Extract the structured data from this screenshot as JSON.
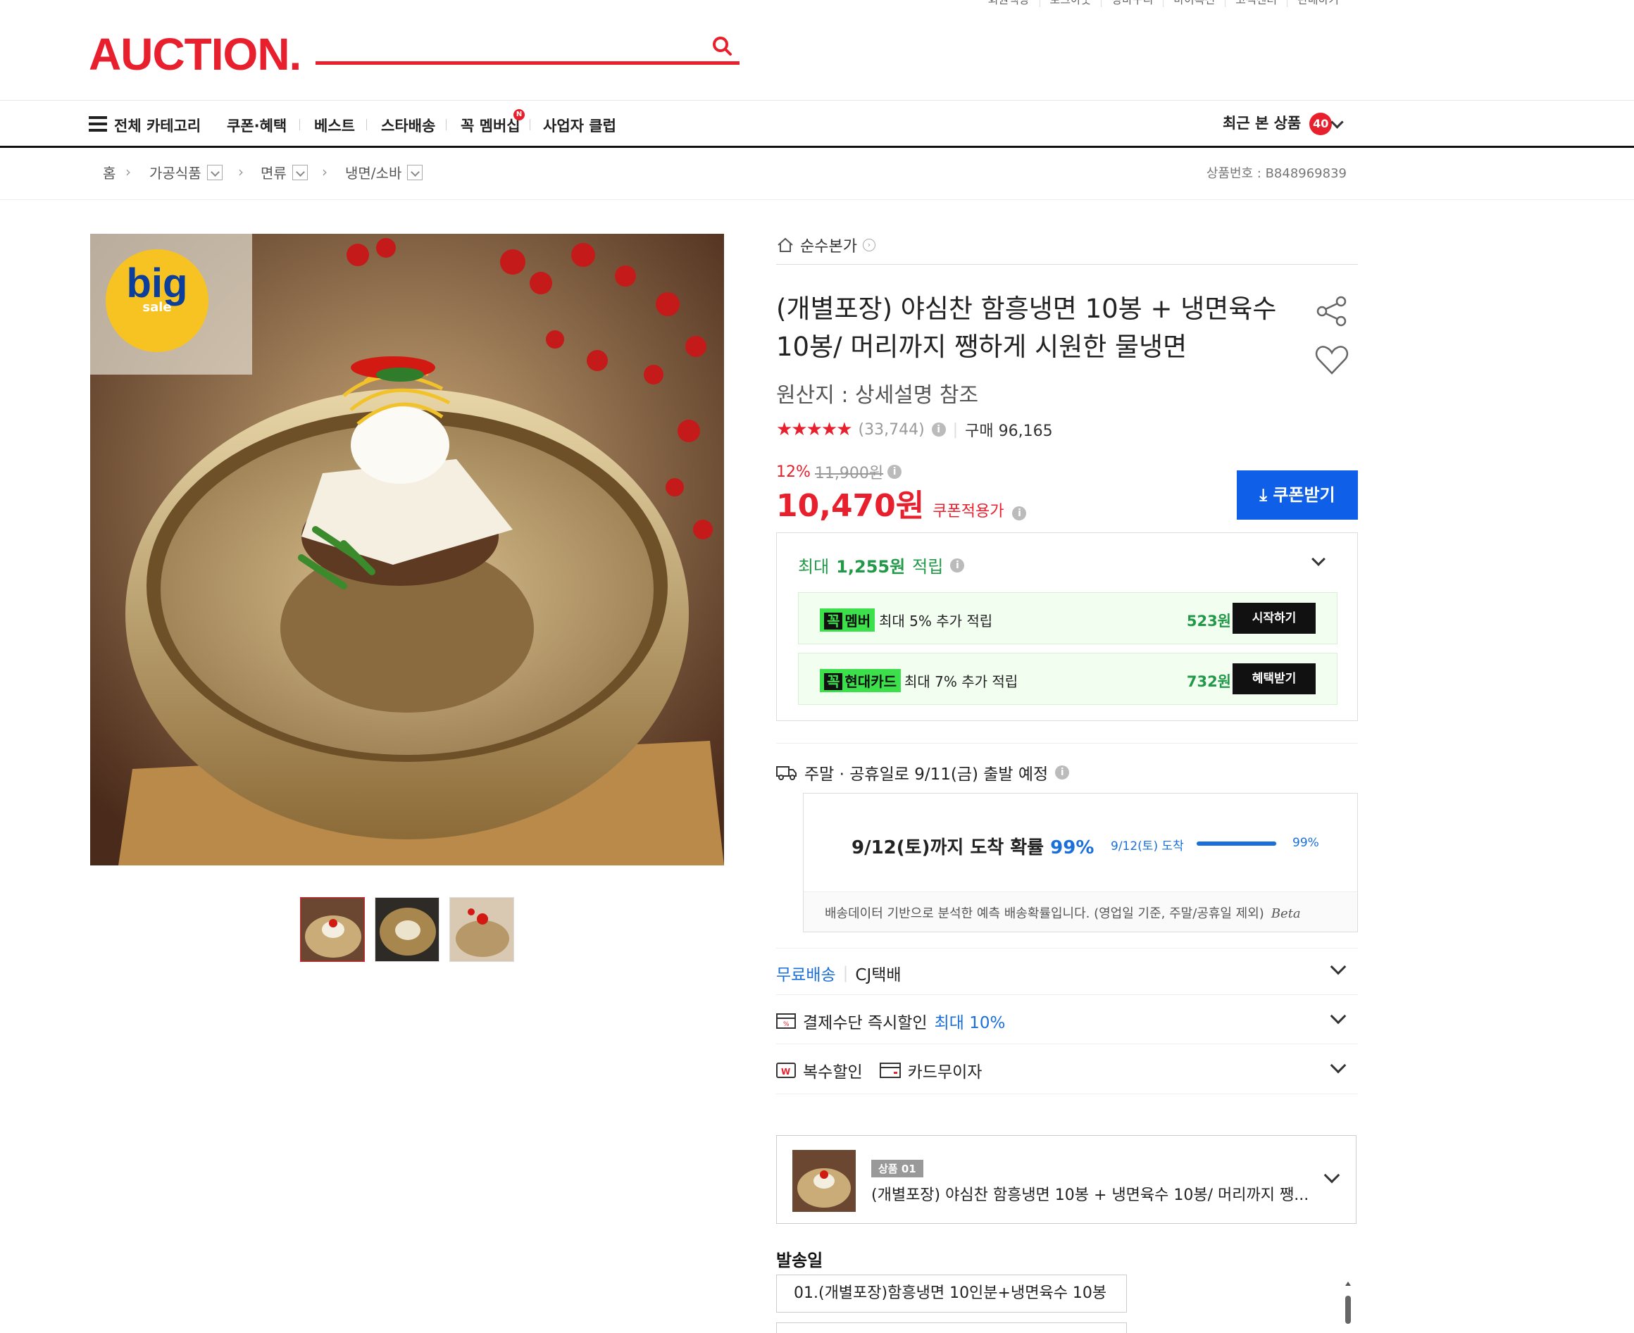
{
  "util_links": [
    "회원색상",
    "로그아웃",
    "장바구니",
    "마이옥션",
    "고객센터",
    "판매하기"
  ],
  "header": {
    "logo": "AUCTION.",
    "search_placeholder": ""
  },
  "gnb": {
    "all_category": "전체 카테고리",
    "items": [
      "쿠폰·혜택",
      "베스트",
      "스타배송",
      "꼭 멤버십",
      "사업자 클럽"
    ],
    "membership_badge": "N",
    "recent_label": "최근 본 상품",
    "recent_count": "40"
  },
  "breadcrumb": {
    "home": "홈",
    "items": [
      "가공식품",
      "면류",
      "냉면/소바"
    ],
    "product_no": "상품번호 : B848969839"
  },
  "gallery": {
    "badge_big": "big",
    "badge_sale": "sale"
  },
  "product": {
    "store": "순수본가",
    "title": "(개별포장) 야심찬 함흥냉면 10봉 + 냉면육수 10봉/ 머리까지 쨍하게 시원한 물냉면",
    "origin": "원산지 : 상세설명 참조",
    "rating_stars": "★★★★★",
    "review_count": "(33,744)",
    "purchase_count": "구매 96,165",
    "discount_pct": "12%",
    "original_price": "11,900원",
    "price": "10,470원",
    "price_label": "쿠폰적용가",
    "coupon_button": "쿠폰받기"
  },
  "reward": {
    "head_prefix": "최대",
    "head_amount": "1,255원",
    "head_suffix": "적립",
    "rows": [
      {
        "tag_k": "꼭",
        "tag": "멤버",
        "text": "최대 5% 추가 적립",
        "amount": "523원",
        "button": "시작하기"
      },
      {
        "tag_k": "꼭",
        "tag": "현대카드",
        "text": "최대 7% 추가 적립",
        "amount": "732원",
        "button": "혜택받기"
      }
    ]
  },
  "shipping": {
    "dispatch": "주말 · 공휴일로 9/11(금) 출발 예정",
    "prob_prefix": "9/12(토)까지 도착 확률",
    "prob_value": "99%",
    "bar_label": "9/12(토) 도착",
    "bar_pct": "99%",
    "bar_fraction": 0.99,
    "note": "배송데이터 기반으로 분석한 예측 배송확률입니다. (영업일 기준, 주말/공휴일 제외)",
    "beta": "Beta"
  },
  "rows": {
    "free_ship": "무료배송",
    "courier": "CJ택배",
    "pay_label": "결제수단 즉시할인",
    "pay_value": "최대 10%",
    "multi": "복수할인",
    "card": "카드무이자"
  },
  "option": {
    "tag": "상품 01",
    "name": "(개별포장) 야심찬 함흥냉면 10봉 + 냉면육수 10봉/ 머리까지 쨍..."
  },
  "send_day": {
    "label": "발송일",
    "selected": "01.(개별포장)함흥냉면 10인분+냉면육수 10봉"
  }
}
